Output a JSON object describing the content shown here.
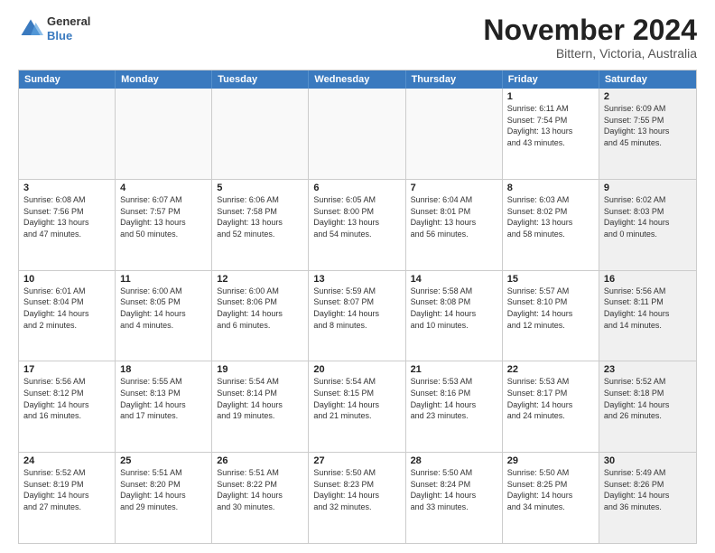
{
  "logo": {
    "general": "General",
    "blue": "Blue"
  },
  "title": "November 2024",
  "location": "Bittern, Victoria, Australia",
  "days_of_week": [
    "Sunday",
    "Monday",
    "Tuesday",
    "Wednesday",
    "Thursday",
    "Friday",
    "Saturday"
  ],
  "weeks": [
    [
      {
        "day": "",
        "info": "",
        "empty": true
      },
      {
        "day": "",
        "info": "",
        "empty": true
      },
      {
        "day": "",
        "info": "",
        "empty": true
      },
      {
        "day": "",
        "info": "",
        "empty": true
      },
      {
        "day": "",
        "info": "",
        "empty": true
      },
      {
        "day": "1",
        "info": "Sunrise: 6:11 AM\nSunset: 7:54 PM\nDaylight: 13 hours\nand 43 minutes."
      },
      {
        "day": "2",
        "info": "Sunrise: 6:09 AM\nSunset: 7:55 PM\nDaylight: 13 hours\nand 45 minutes.",
        "shaded": true
      }
    ],
    [
      {
        "day": "3",
        "info": "Sunrise: 6:08 AM\nSunset: 7:56 PM\nDaylight: 13 hours\nand 47 minutes."
      },
      {
        "day": "4",
        "info": "Sunrise: 6:07 AM\nSunset: 7:57 PM\nDaylight: 13 hours\nand 50 minutes."
      },
      {
        "day": "5",
        "info": "Sunrise: 6:06 AM\nSunset: 7:58 PM\nDaylight: 13 hours\nand 52 minutes."
      },
      {
        "day": "6",
        "info": "Sunrise: 6:05 AM\nSunset: 8:00 PM\nDaylight: 13 hours\nand 54 minutes."
      },
      {
        "day": "7",
        "info": "Sunrise: 6:04 AM\nSunset: 8:01 PM\nDaylight: 13 hours\nand 56 minutes."
      },
      {
        "day": "8",
        "info": "Sunrise: 6:03 AM\nSunset: 8:02 PM\nDaylight: 13 hours\nand 58 minutes."
      },
      {
        "day": "9",
        "info": "Sunrise: 6:02 AM\nSunset: 8:03 PM\nDaylight: 14 hours\nand 0 minutes.",
        "shaded": true
      }
    ],
    [
      {
        "day": "10",
        "info": "Sunrise: 6:01 AM\nSunset: 8:04 PM\nDaylight: 14 hours\nand 2 minutes."
      },
      {
        "day": "11",
        "info": "Sunrise: 6:00 AM\nSunset: 8:05 PM\nDaylight: 14 hours\nand 4 minutes."
      },
      {
        "day": "12",
        "info": "Sunrise: 6:00 AM\nSunset: 8:06 PM\nDaylight: 14 hours\nand 6 minutes."
      },
      {
        "day": "13",
        "info": "Sunrise: 5:59 AM\nSunset: 8:07 PM\nDaylight: 14 hours\nand 8 minutes."
      },
      {
        "day": "14",
        "info": "Sunrise: 5:58 AM\nSunset: 8:08 PM\nDaylight: 14 hours\nand 10 minutes."
      },
      {
        "day": "15",
        "info": "Sunrise: 5:57 AM\nSunset: 8:10 PM\nDaylight: 14 hours\nand 12 minutes."
      },
      {
        "day": "16",
        "info": "Sunrise: 5:56 AM\nSunset: 8:11 PM\nDaylight: 14 hours\nand 14 minutes.",
        "shaded": true
      }
    ],
    [
      {
        "day": "17",
        "info": "Sunrise: 5:56 AM\nSunset: 8:12 PM\nDaylight: 14 hours\nand 16 minutes."
      },
      {
        "day": "18",
        "info": "Sunrise: 5:55 AM\nSunset: 8:13 PM\nDaylight: 14 hours\nand 17 minutes."
      },
      {
        "day": "19",
        "info": "Sunrise: 5:54 AM\nSunset: 8:14 PM\nDaylight: 14 hours\nand 19 minutes."
      },
      {
        "day": "20",
        "info": "Sunrise: 5:54 AM\nSunset: 8:15 PM\nDaylight: 14 hours\nand 21 minutes."
      },
      {
        "day": "21",
        "info": "Sunrise: 5:53 AM\nSunset: 8:16 PM\nDaylight: 14 hours\nand 23 minutes."
      },
      {
        "day": "22",
        "info": "Sunrise: 5:53 AM\nSunset: 8:17 PM\nDaylight: 14 hours\nand 24 minutes."
      },
      {
        "day": "23",
        "info": "Sunrise: 5:52 AM\nSunset: 8:18 PM\nDaylight: 14 hours\nand 26 minutes.",
        "shaded": true
      }
    ],
    [
      {
        "day": "24",
        "info": "Sunrise: 5:52 AM\nSunset: 8:19 PM\nDaylight: 14 hours\nand 27 minutes."
      },
      {
        "day": "25",
        "info": "Sunrise: 5:51 AM\nSunset: 8:20 PM\nDaylight: 14 hours\nand 29 minutes."
      },
      {
        "day": "26",
        "info": "Sunrise: 5:51 AM\nSunset: 8:22 PM\nDaylight: 14 hours\nand 30 minutes."
      },
      {
        "day": "27",
        "info": "Sunrise: 5:50 AM\nSunset: 8:23 PM\nDaylight: 14 hours\nand 32 minutes."
      },
      {
        "day": "28",
        "info": "Sunrise: 5:50 AM\nSunset: 8:24 PM\nDaylight: 14 hours\nand 33 minutes."
      },
      {
        "day": "29",
        "info": "Sunrise: 5:50 AM\nSunset: 8:25 PM\nDaylight: 14 hours\nand 34 minutes."
      },
      {
        "day": "30",
        "info": "Sunrise: 5:49 AM\nSunset: 8:26 PM\nDaylight: 14 hours\nand 36 minutes.",
        "shaded": true
      }
    ]
  ]
}
